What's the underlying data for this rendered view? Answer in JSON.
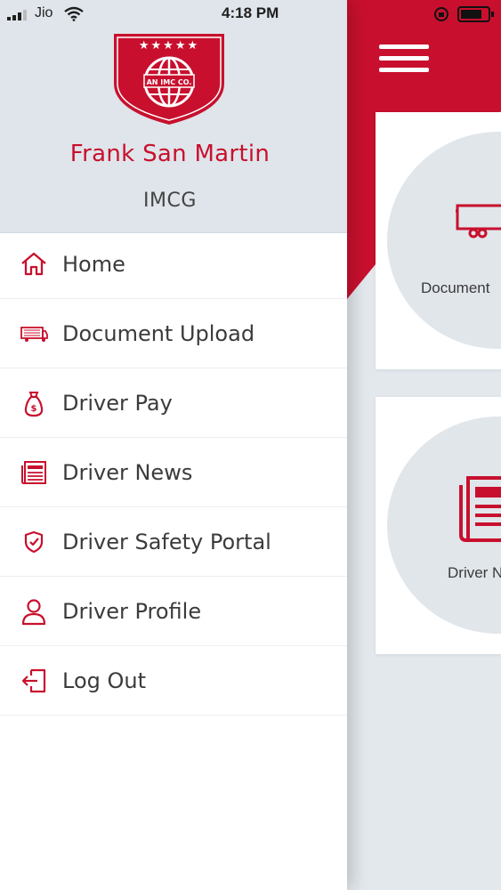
{
  "status_bar": {
    "carrier": "Jio",
    "time": "4:18 PM"
  },
  "drawer": {
    "logo_text": "AN IMC CO.",
    "user_name": "Frank San Martin",
    "company": "IMCG",
    "menu": [
      {
        "label": "Home",
        "icon": "home-icon"
      },
      {
        "label": "Document Upload",
        "icon": "truck-icon"
      },
      {
        "label": "Driver Pay",
        "icon": "money-bag-icon"
      },
      {
        "label": "Driver News",
        "icon": "newspaper-icon"
      },
      {
        "label": "Driver Safety Portal",
        "icon": "shield-check-icon"
      },
      {
        "label": "Driver Profile",
        "icon": "user-icon"
      },
      {
        "label": "Log Out",
        "icon": "logout-icon"
      }
    ]
  },
  "background": {
    "cards": [
      {
        "label": "Document",
        "icon": "truck-icon"
      },
      {
        "label": "Driver N",
        "icon": "newspaper-icon"
      }
    ]
  },
  "colors": {
    "brand_red": "#c8102e",
    "header_bg": "#dfe5ea",
    "text": "#3b3b3b"
  }
}
